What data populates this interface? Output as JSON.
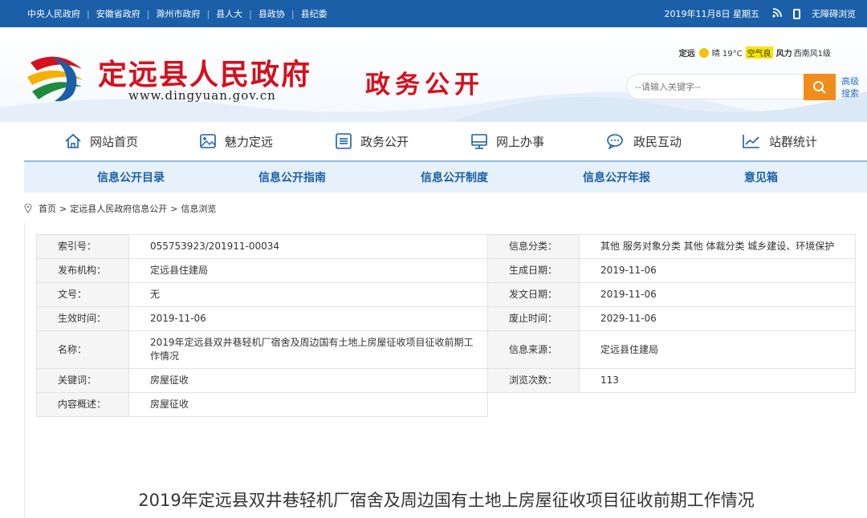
{
  "topbar": {
    "links": [
      "中央人民政府",
      "安徽省政府",
      "滁州市政府",
      "县人大",
      "县政协",
      "县纪委"
    ],
    "date": "2019年11月8日 星期五",
    "accessibility": "无障碍浏览",
    "icons": [
      "rss-icon",
      "phone-icon"
    ],
    "bg_color": "#1a5fa8"
  },
  "header": {
    "site_title": "定远县人民政府",
    "site_url": "www.dingyuan.gov.cn",
    "section_title": "政务公开",
    "title_color": "#d5101d",
    "weather": {
      "city": "定远",
      "condition": "晴 19°C",
      "air_label": "空气良",
      "wind_label": "风力",
      "wind_value": "西南风1级"
    },
    "search": {
      "placeholder": "--请输入关键字--",
      "advanced": "高级搜索"
    },
    "accent_color": "#f28c1a"
  },
  "nav": {
    "items": [
      {
        "label": "网站首页",
        "icon": "home-icon"
      },
      {
        "label": "魅力定远",
        "icon": "picture-icon"
      },
      {
        "label": "政务公开",
        "icon": "list-icon"
      },
      {
        "label": "网上办事",
        "icon": "monitor-icon"
      },
      {
        "label": "政民互动",
        "icon": "chat-icon"
      },
      {
        "label": "站群统计",
        "icon": "chart-icon"
      }
    ]
  },
  "subnav": {
    "items": [
      "信息公开目录",
      "信息公开指南",
      "信息公开制度",
      "信息公开年报",
      "意见箱"
    ],
    "color": "#1a5fa8"
  },
  "breadcrumb": [
    "首页",
    "定远县人民政府信息公开",
    "信息浏览"
  ],
  "info": {
    "rows": [
      {
        "l_label": "索引号：",
        "l_value": "055753923/201911-00034",
        "r_label": "信息分类：",
        "r_value": "其他  服务对象分类  其他  体裁分类  城乡建设、环境保护"
      },
      {
        "l_label": "发布机构：",
        "l_value": "定远县住建局",
        "r_label": "生成日期：",
        "r_value": "2019-11-06"
      },
      {
        "l_label": "文号：",
        "l_value": "无",
        "r_label": "发文日期：",
        "r_value": "2019-11-06"
      },
      {
        "l_label": "生效时间：",
        "l_value": "2019-11-06",
        "r_label": "废止时间：",
        "r_value": "2029-11-06"
      },
      {
        "l_label": "名称：",
        "l_value": "2019年定远县双井巷轻机厂宿舍及周边国有土地上房屋征收项目征收前期工作情况",
        "r_label": "信息来源：",
        "r_value": "定远县住建局"
      },
      {
        "l_label": "关键词：",
        "l_value": "房屋征收",
        "r_label": "浏览次数：",
        "r_value": "113"
      },
      {
        "l_label": "内容概述：",
        "l_value": "房屋征收"
      }
    ]
  },
  "article": {
    "title": "2019年定远县双井巷轻机厂宿舍及周边国有土地上房屋征收项目征收前期工作情况"
  }
}
